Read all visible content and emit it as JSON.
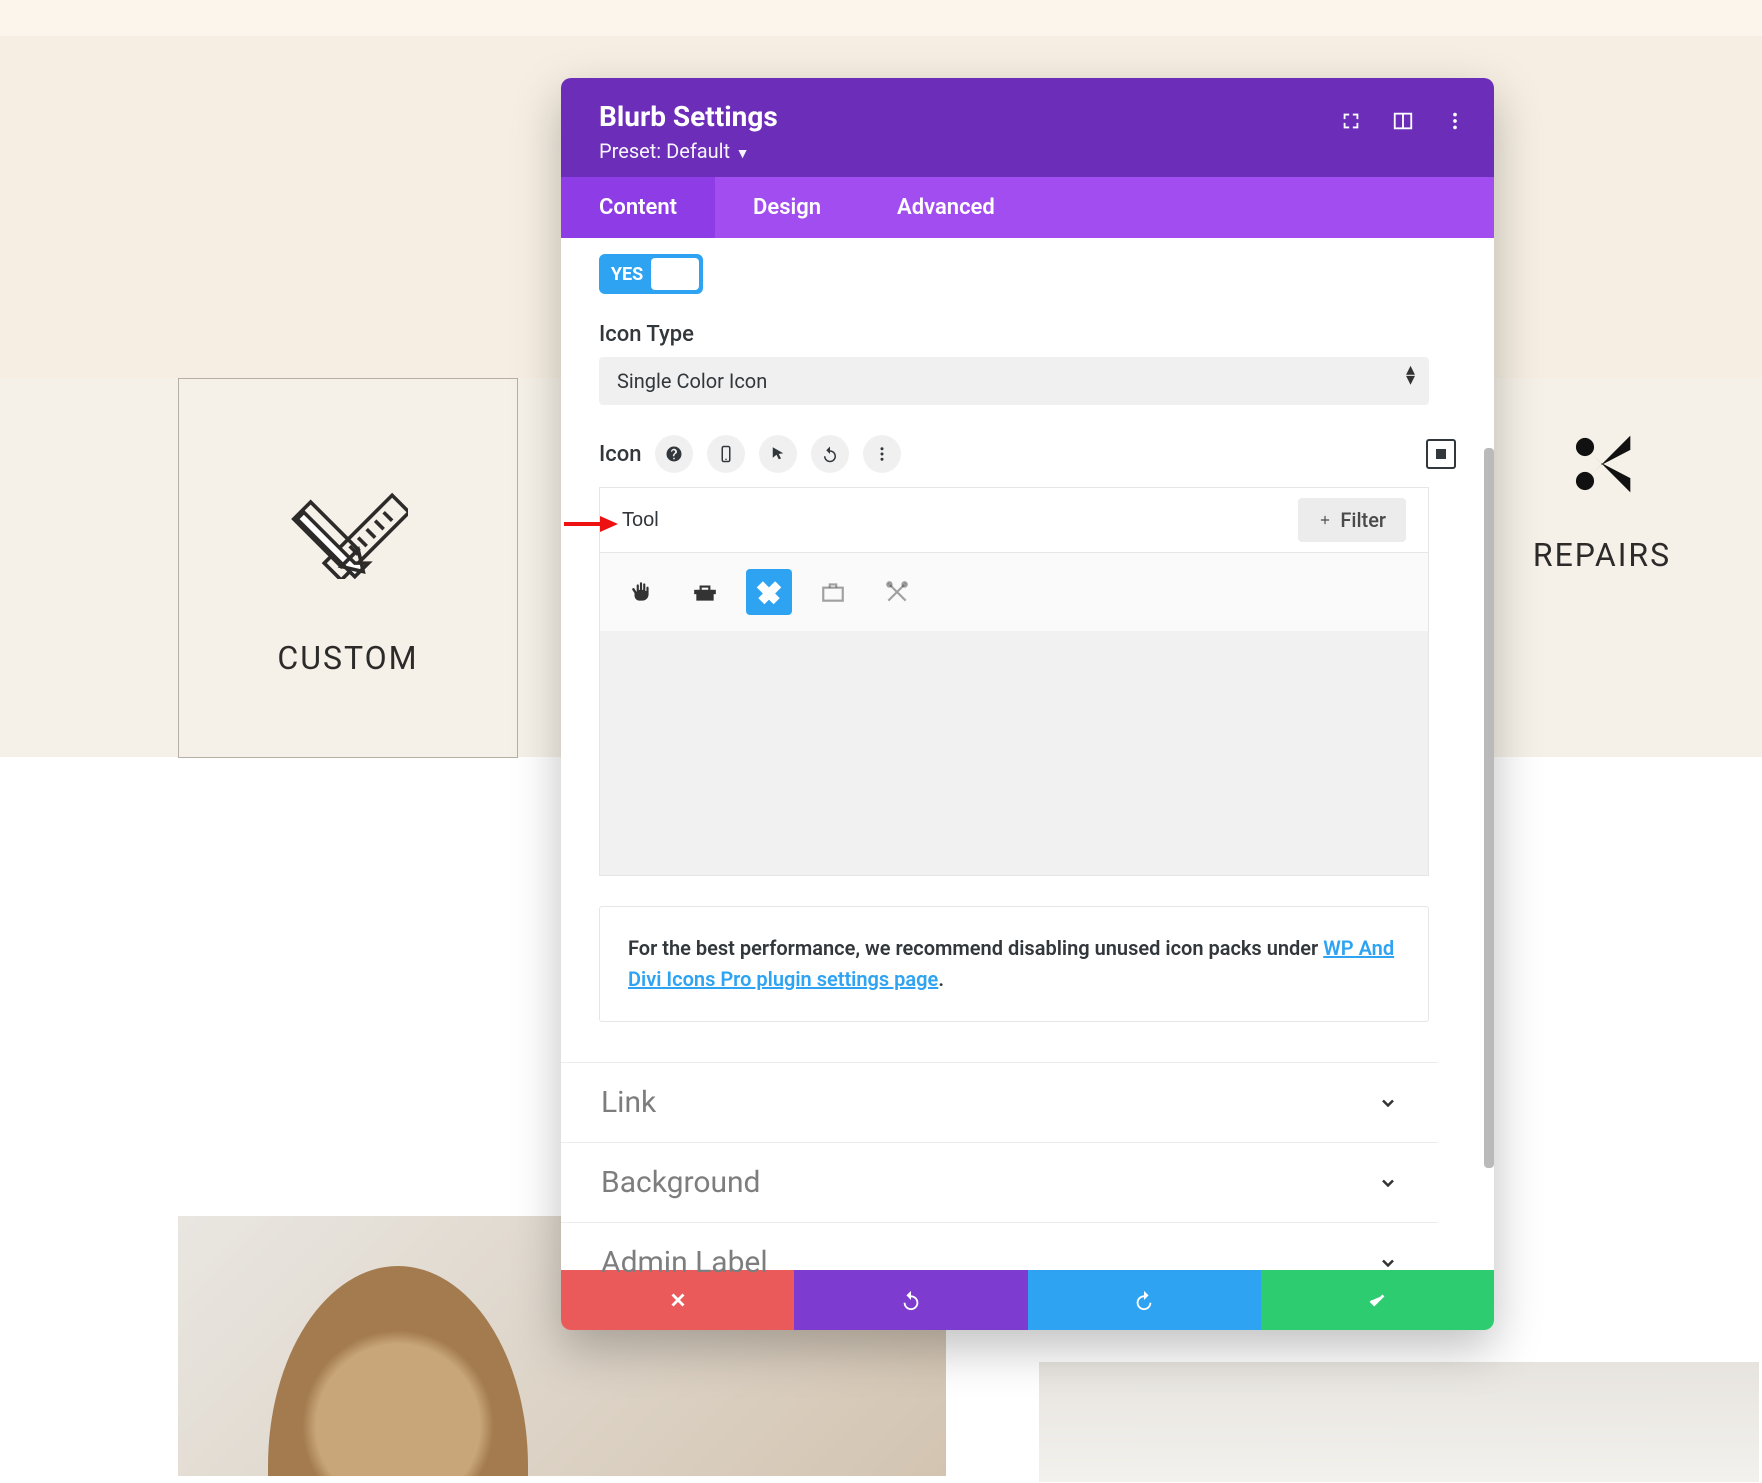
{
  "page": {
    "left_card_label": "CUSTOM",
    "right_card_label": "REPAIRS"
  },
  "modal": {
    "title": "Blurb Settings",
    "preset_label": "Preset: Default",
    "tabs": {
      "content": "Content",
      "design": "Design",
      "advanced": "Advanced"
    },
    "toggle_yes": "YES",
    "icon_type_label": "Icon Type",
    "icon_type_value": "Single Color Icon",
    "icon_label": "Icon",
    "icon_helper_pills": [
      "help",
      "mobile",
      "cursor",
      "undo",
      "more"
    ],
    "search_value": "Tool",
    "filter_label": "Filter",
    "icon_results": [
      {
        "name": "hand-grab-icon",
        "selected": false,
        "dim": false
      },
      {
        "name": "toolbox-icon",
        "selected": false,
        "dim": false
      },
      {
        "name": "ruler-cross-icon",
        "selected": true,
        "dim": false
      },
      {
        "name": "briefcase-icon",
        "selected": false,
        "dim": true
      },
      {
        "name": "tools-cross-icon",
        "selected": false,
        "dim": true
      }
    ],
    "notice_prefix": "For the best performance, we recommend disabling unused icon packs under ",
    "notice_link": "WP And Divi Icons Pro plugin settings page",
    "notice_suffix": ".",
    "accordion": {
      "link": "Link",
      "background": "Background",
      "admin_label": "Admin Label"
    }
  }
}
